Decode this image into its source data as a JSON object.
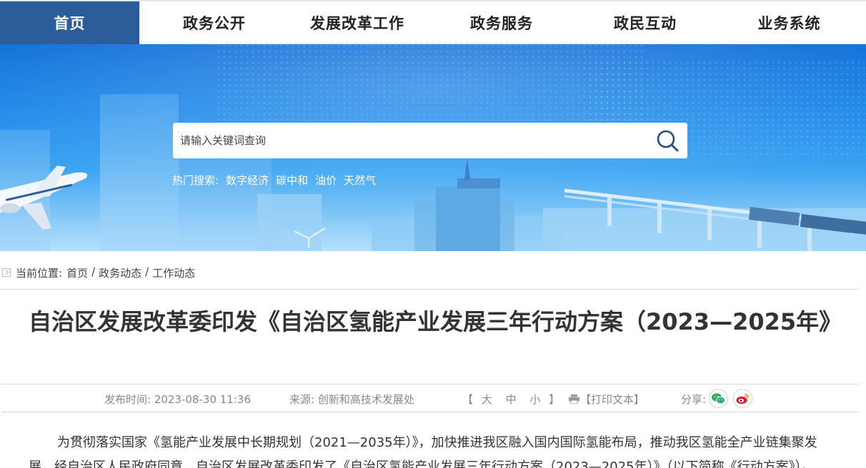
{
  "nav": {
    "items": [
      "首页",
      "政务公开",
      "发展改革工作",
      "政务服务",
      "政民互动",
      "业务系统"
    ],
    "active_index": 0
  },
  "search": {
    "placeholder": "请输入关键词查询"
  },
  "hot_search": {
    "label": "热门搜索:",
    "items": [
      "数字经济",
      "碳中和",
      "油价",
      "天然气"
    ]
  },
  "breadcrumb": {
    "label": "当前位置:",
    "items": [
      "首页",
      "政务动态",
      "工作动态"
    ],
    "separator": "/"
  },
  "article": {
    "title": "自治区发展改革委印发《自治区氢能产业发展三年行动方案（2023—2025年》",
    "publish_label": "发布时间:",
    "publish_time": "2023-08-30 11:36",
    "source_label": "来源:",
    "source": "创新和高技术发展处",
    "font_bracket_open": "【",
    "font_sizes": [
      "大",
      "中",
      "小"
    ],
    "font_bracket_close": "】",
    "print_label": "【打印文本】",
    "share_label": "分享:",
    "body": "为贯彻落实国家《氢能产业发展中长期规划（2021—2035年）》，加快推进我区融入国内国际氢能布局，推动我区氢能全产业链集聚发展，经自治区人民政府同意，自治区发展改革委印发了《自治区氢能产业发展三年行动方案（2023—2025年）》（以下简称《行动方案》）。"
  },
  "colors": {
    "nav_active_bg": "#2a5d99",
    "banner_blue": "#1a86e8",
    "wechat_green": "#2aae67",
    "weibo_red": "#e6162d"
  },
  "icons": [
    "search-icon",
    "breadcrumb-arrow-icon",
    "print-icon",
    "wechat-icon",
    "weibo-icon"
  ]
}
